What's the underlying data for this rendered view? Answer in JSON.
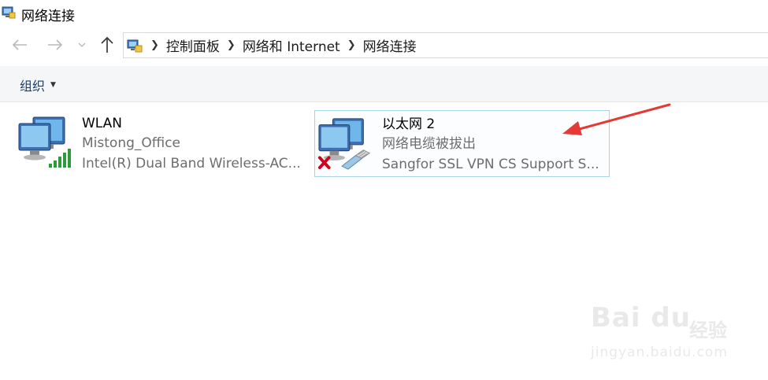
{
  "window": {
    "title": "网络连接"
  },
  "address_bar": {
    "crumbs": [
      "控制面板",
      "网络和 Internet",
      "网络连接"
    ]
  },
  "toolbar": {
    "organize_label": "组织"
  },
  "connections": [
    {
      "name": "WLAN",
      "status": "Mistong_Office",
      "device": "Intel(R) Dual Band Wireless-AC...",
      "icon": "wifi-signal-icon",
      "selected": false
    },
    {
      "name": "以太网 2",
      "status": "网络电缆被拔出",
      "device": "Sangfor SSL VPN CS Support S...",
      "icon": "ethernet-cable-unplugged-icon",
      "selected": true
    }
  ],
  "annotation": {
    "color": "#e53935"
  },
  "watermark": {
    "brand": "Bai du",
    "brand_suffix": "经验",
    "url": "jingyan.baidu.com"
  },
  "colors": {
    "signal": "#2e9a3c",
    "selection_border": "#a8d3ec",
    "error_x": "#d0021b"
  }
}
